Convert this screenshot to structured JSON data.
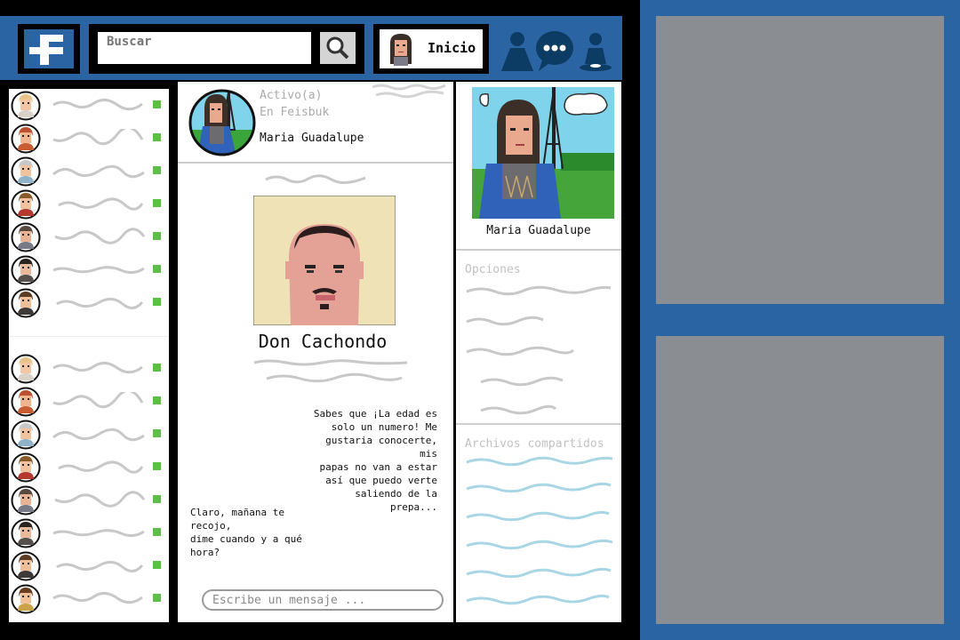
{
  "header": {
    "logo_icon": "facebook-f-logo",
    "search_placeholder": "Buscar",
    "search_icon": "magnifier-icon",
    "home_label": "Inicio",
    "nav_icons": [
      "friends-icon",
      "messages-icon",
      "notifications-icon"
    ],
    "brand_color": "#2b64a3"
  },
  "friends": {
    "status_color": "#5dbf4a",
    "items": [
      {
        "avatar": "blond-man-avatar",
        "online": true
      },
      {
        "avatar": "curly-red-hair-avatar",
        "online": true
      },
      {
        "avatar": "old-man-avatar",
        "online": true
      },
      {
        "avatar": "brown-hair-avatar",
        "online": true
      },
      {
        "avatar": "long-hair-woman-avatar",
        "online": true
      },
      {
        "avatar": "dark-hair-woman-avatar",
        "online": true
      },
      {
        "avatar": "short-hair-man-avatar",
        "online": true
      },
      {
        "avatar": "blond-man-avatar",
        "online": true
      },
      {
        "avatar": "curly-red-hair-avatar",
        "online": true
      },
      {
        "avatar": "old-man-avatar",
        "online": true
      },
      {
        "avatar": "brown-hair-avatar",
        "online": true
      },
      {
        "avatar": "long-hair-woman-avatar",
        "online": true
      },
      {
        "avatar": "dark-hair-woman-avatar",
        "online": true
      },
      {
        "avatar": "short-hair-man-avatar",
        "online": true
      },
      {
        "avatar": "brown-hair-woman-avatar",
        "online": true
      }
    ]
  },
  "chat": {
    "status_line1": "Activo(a)",
    "status_line2": "En Feisbuk",
    "header_name": "Maria Guadalupe",
    "contact_name": "Don Cachondo",
    "incoming_message": "Sabes que ¡La edad es\nsolo un numero! Me\ngustaria conocerte, mis\npapas no van a estar\nasí que puedo verte\nsaliendo de la prepa...",
    "outgoing_message": "Claro, mañana te\nrecojo,\ndime cuando y a qué\nhora?",
    "input_placeholder": "Escribe un mensaje ..."
  },
  "sidebar": {
    "profile_name": "Maria Guadalupe",
    "options_title": "Opciones",
    "files_title": "Archivos compartidos",
    "scribble_gray": "#c8c8c8",
    "scribble_blue": "#a9d6e5"
  },
  "ads": {
    "color": "#8a8e92"
  }
}
